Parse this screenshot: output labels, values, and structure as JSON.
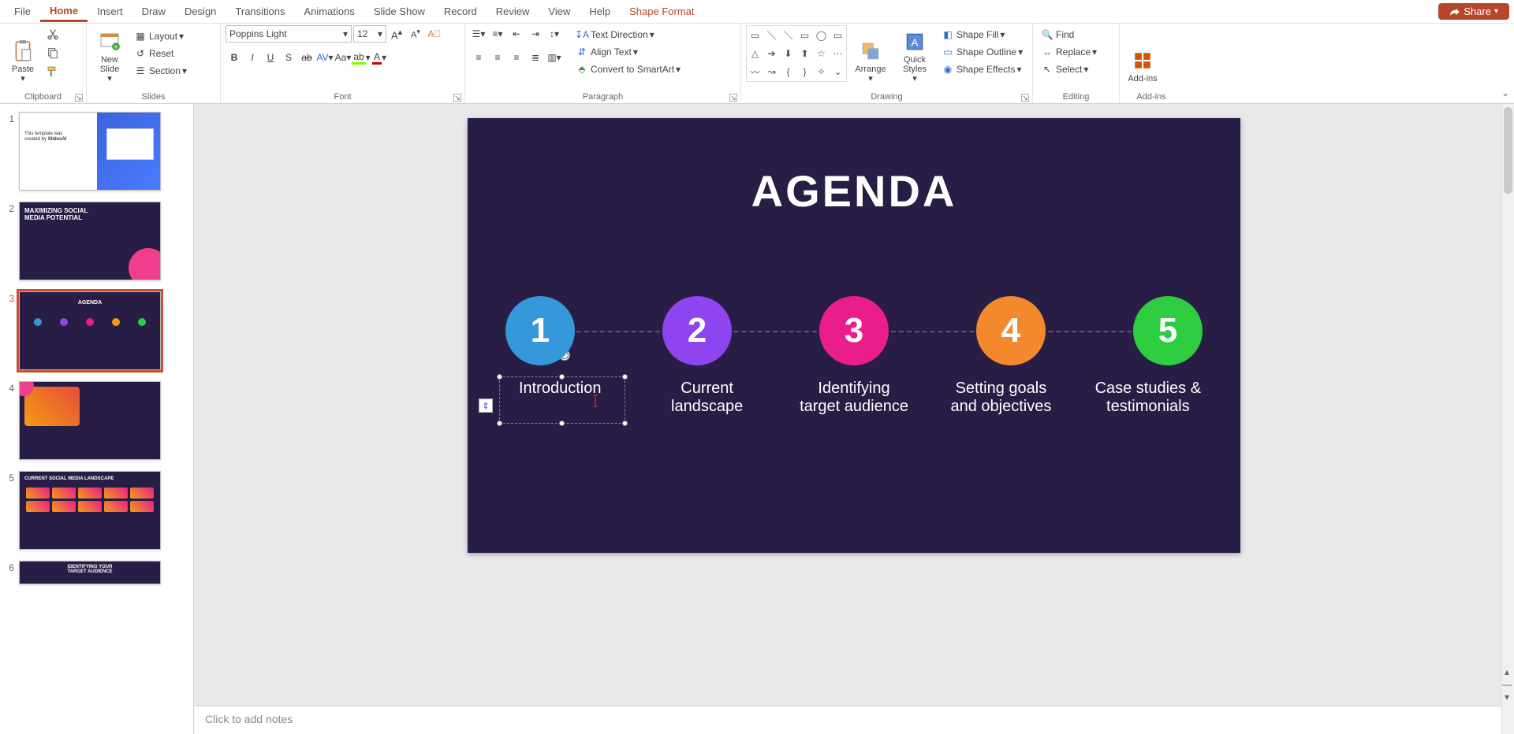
{
  "menu": {
    "items": [
      "File",
      "Home",
      "Insert",
      "Draw",
      "Design",
      "Transitions",
      "Animations",
      "Slide Show",
      "Record",
      "Review",
      "View",
      "Help",
      "Shape Format"
    ],
    "active": 1,
    "contextual": 12,
    "share": "Share"
  },
  "ribbon": {
    "clipboard": {
      "paste": "Paste",
      "label": "Clipboard"
    },
    "slides": {
      "new": "New\nSlide",
      "layout": "Layout",
      "reset": "Reset",
      "section": "Section",
      "label": "Slides"
    },
    "font": {
      "name": "Poppins Light",
      "size": "12",
      "label": "Font"
    },
    "paragraph": {
      "textdir": "Text Direction",
      "align": "Align Text",
      "smart": "Convert to SmartArt",
      "label": "Paragraph"
    },
    "drawing": {
      "arrange": "Arrange",
      "quick": "Quick\nStyles",
      "fill": "Shape Fill",
      "outline": "Shape Outline",
      "effects": "Shape Effects",
      "label": "Drawing"
    },
    "editing": {
      "find": "Find",
      "replace": "Replace",
      "select": "Select",
      "label": "Editing"
    },
    "addins": {
      "btn": "Add-ins",
      "label": "Add-ins"
    }
  },
  "thumbs": {
    "s1": "1",
    "s2": "2",
    "s3": "3",
    "s4": "4",
    "s5": "5",
    "s6": "6",
    "t2a": "MAXIMIZING SOCIAL",
    "t2b": "MEDIA POTENTIAL",
    "t3": "AGENDA",
    "t5": "CURRENT SOCIAL MEDIA LANDSCAPE",
    "t6a": "IDENTIFYING YOUR",
    "t6b": "TARGET AUDIENCE"
  },
  "slide": {
    "title": "AGENDA",
    "n1": "1",
    "n2": "2",
    "n3": "3",
    "n4": "4",
    "n5": "5",
    "l1": "Introduction",
    "l2a": "Current",
    "l2b": "landscape",
    "l3a": "Identifying",
    "l3b": "target audience",
    "l4a": "Setting goals",
    "l4b": "and objectives",
    "l5a": "Case studies &",
    "l5b": "testimonials"
  },
  "notes": {
    "placeholder": "Click to add notes"
  }
}
